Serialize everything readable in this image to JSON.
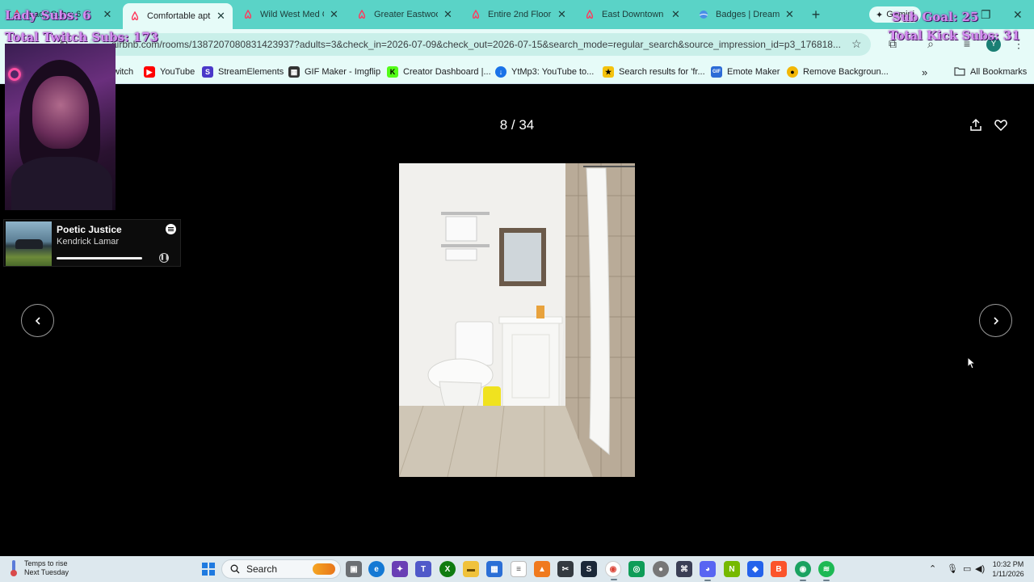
{
  "browser": {
    "tabs": [
      {
        "label": "Lady Subs: 6",
        "favicon": "airbnb-icon",
        "active": false
      },
      {
        "label": "Comfortable apt",
        "favicon": "airbnb-icon",
        "active": true
      },
      {
        "label": "Wild West Med C",
        "favicon": "airbnb-icon",
        "active": false
      },
      {
        "label": "Greater Eastwoo",
        "favicon": "airbnb-icon",
        "active": false
      },
      {
        "label": "Entire 2nd Floor",
        "favicon": "airbnb-icon",
        "active": false
      },
      {
        "label": "East Downtown",
        "favicon": "airbnb-icon",
        "active": false
      },
      {
        "label": "Badges | Dream",
        "favicon": "web-icon",
        "active": false
      }
    ],
    "new_tab": "+",
    "gemini_label": "Gemini",
    "address": "airbnb.com/rooms/1387207080831423937?adults=3&check_in=2026-07-09&check_out=2026-07-15&search_mode=regular_search&source_impression_id=p3_176818...",
    "bookmarks": [
      {
        "label": "witch",
        "icon": "twitch-icon",
        "color": "#9146ff"
      },
      {
        "label": "YouTube",
        "icon": "youtube-icon",
        "color": "#ff0000"
      },
      {
        "label": "StreamElements",
        "icon": "streamelements-icon",
        "color": "#4a38c9"
      },
      {
        "label": "GIF Maker - Imgflip",
        "icon": "imgflip-icon",
        "color": "#333333"
      },
      {
        "label": "Creator Dashboard |...",
        "icon": "kick-icon",
        "color": "#53fc18"
      },
      {
        "label": "YtMp3: YouTube to...",
        "icon": "ytmp3-icon",
        "color": "#1a73e8"
      },
      {
        "label": "Search results for 'fr...",
        "icon": "search-result-icon",
        "color": "#f4c20d"
      },
      {
        "label": "Emote Maker",
        "icon": "gif-icon",
        "color": "#2c6bd6"
      },
      {
        "label": "Remove Backgroun...",
        "icon": "removebg-icon",
        "color": "#f2b705"
      }
    ],
    "bookmarks_more": "»",
    "all_bookmarks": "All Bookmarks"
  },
  "overlay": {
    "top_left": "Lady Subs: 6",
    "twitch_subs": "Total Twitch Subs: 173",
    "sub_goal": "Sub Goal: 25",
    "kick_subs": "Total Kick Subs: 31"
  },
  "now_playing": {
    "title": "Poetic Justice",
    "artist": "Kendrick Lamar",
    "progress": 1.0
  },
  "viewer": {
    "counter": "8 / 34",
    "prev_label": "‹",
    "next_label": "›"
  },
  "taskbar": {
    "weather_line1": "Temps to rise",
    "weather_line2": "Next Tuesday",
    "search_label": "Search",
    "time": "10:32 PM",
    "date": "1/11/2026"
  },
  "colors": {
    "tabstrip": "#5ad3c7",
    "toolbar": "#e6fbf8",
    "overlay_text": "#d58cf0",
    "airbnb": "#ff385c"
  }
}
